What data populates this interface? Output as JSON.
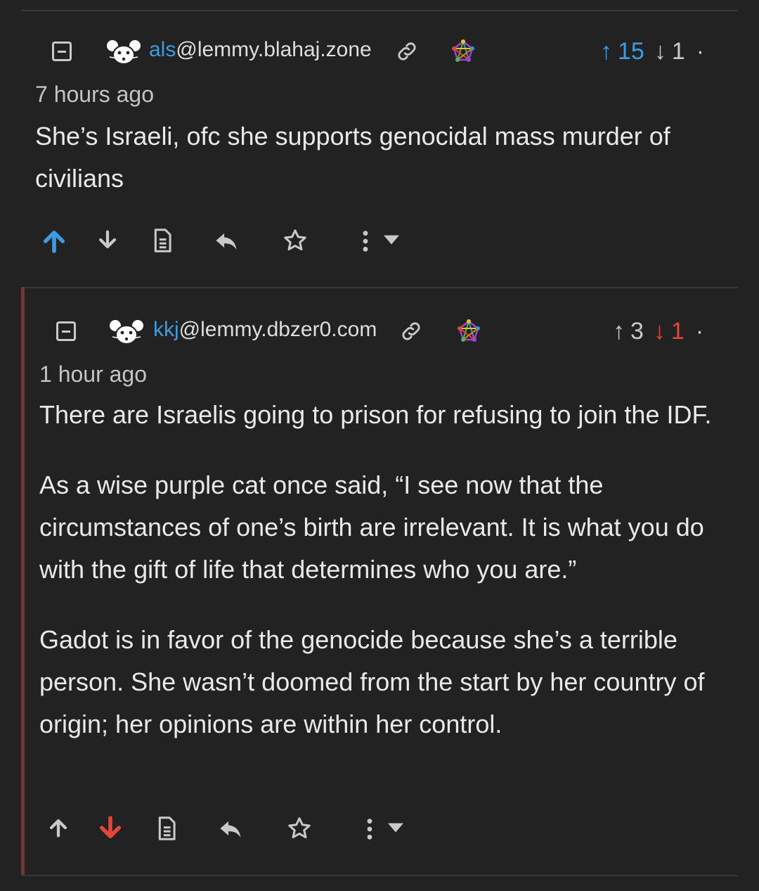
{
  "colors": {
    "background": "#222222",
    "link": "#3d9be0",
    "upvote": "#3d9be0",
    "downvote": "#e2463a",
    "thread_bar": "#6a3838",
    "text": "#e9e9e9"
  },
  "comments": [
    {
      "username": "als",
      "instance": "@lemmy.blahaj.zone",
      "time": "7 hours ago",
      "upvotes": "15",
      "downvotes": "1",
      "paragraphs": [
        "She’s Israeli, ofc she supports genocidal mass murder of civilians"
      ],
      "user_vote": "up"
    },
    {
      "username": "kkj",
      "instance": "@lemmy.dbzer0.com",
      "time": "1 hour ago",
      "upvotes": "3",
      "downvotes": "1",
      "paragraphs": [
        "There are Israelis going to prison for refusing to join the IDF.",
        "As a wise purple cat once said, “I see now that the circumstances of one’s birth are irrelevant. It is what you do with the gift of life that determines who you are.”",
        "Gadot is in favor of the genocide because she’s a terrible person. She wasn’t doomed from the start by her country of origin; her opinions are within her control."
      ],
      "user_vote": "down"
    }
  ],
  "icons": {
    "collapse": "minus-square-icon",
    "avatar": "mouse-avatar-icon",
    "link": "link-icon",
    "fediverse": "fediverse-icon",
    "upvote": "arrow-up-icon",
    "downvote": "arrow-down-icon",
    "source": "document-icon",
    "reply": "reply-icon",
    "save": "star-icon",
    "more": "more-vertical-icon",
    "dropdown": "caret-down-icon"
  }
}
